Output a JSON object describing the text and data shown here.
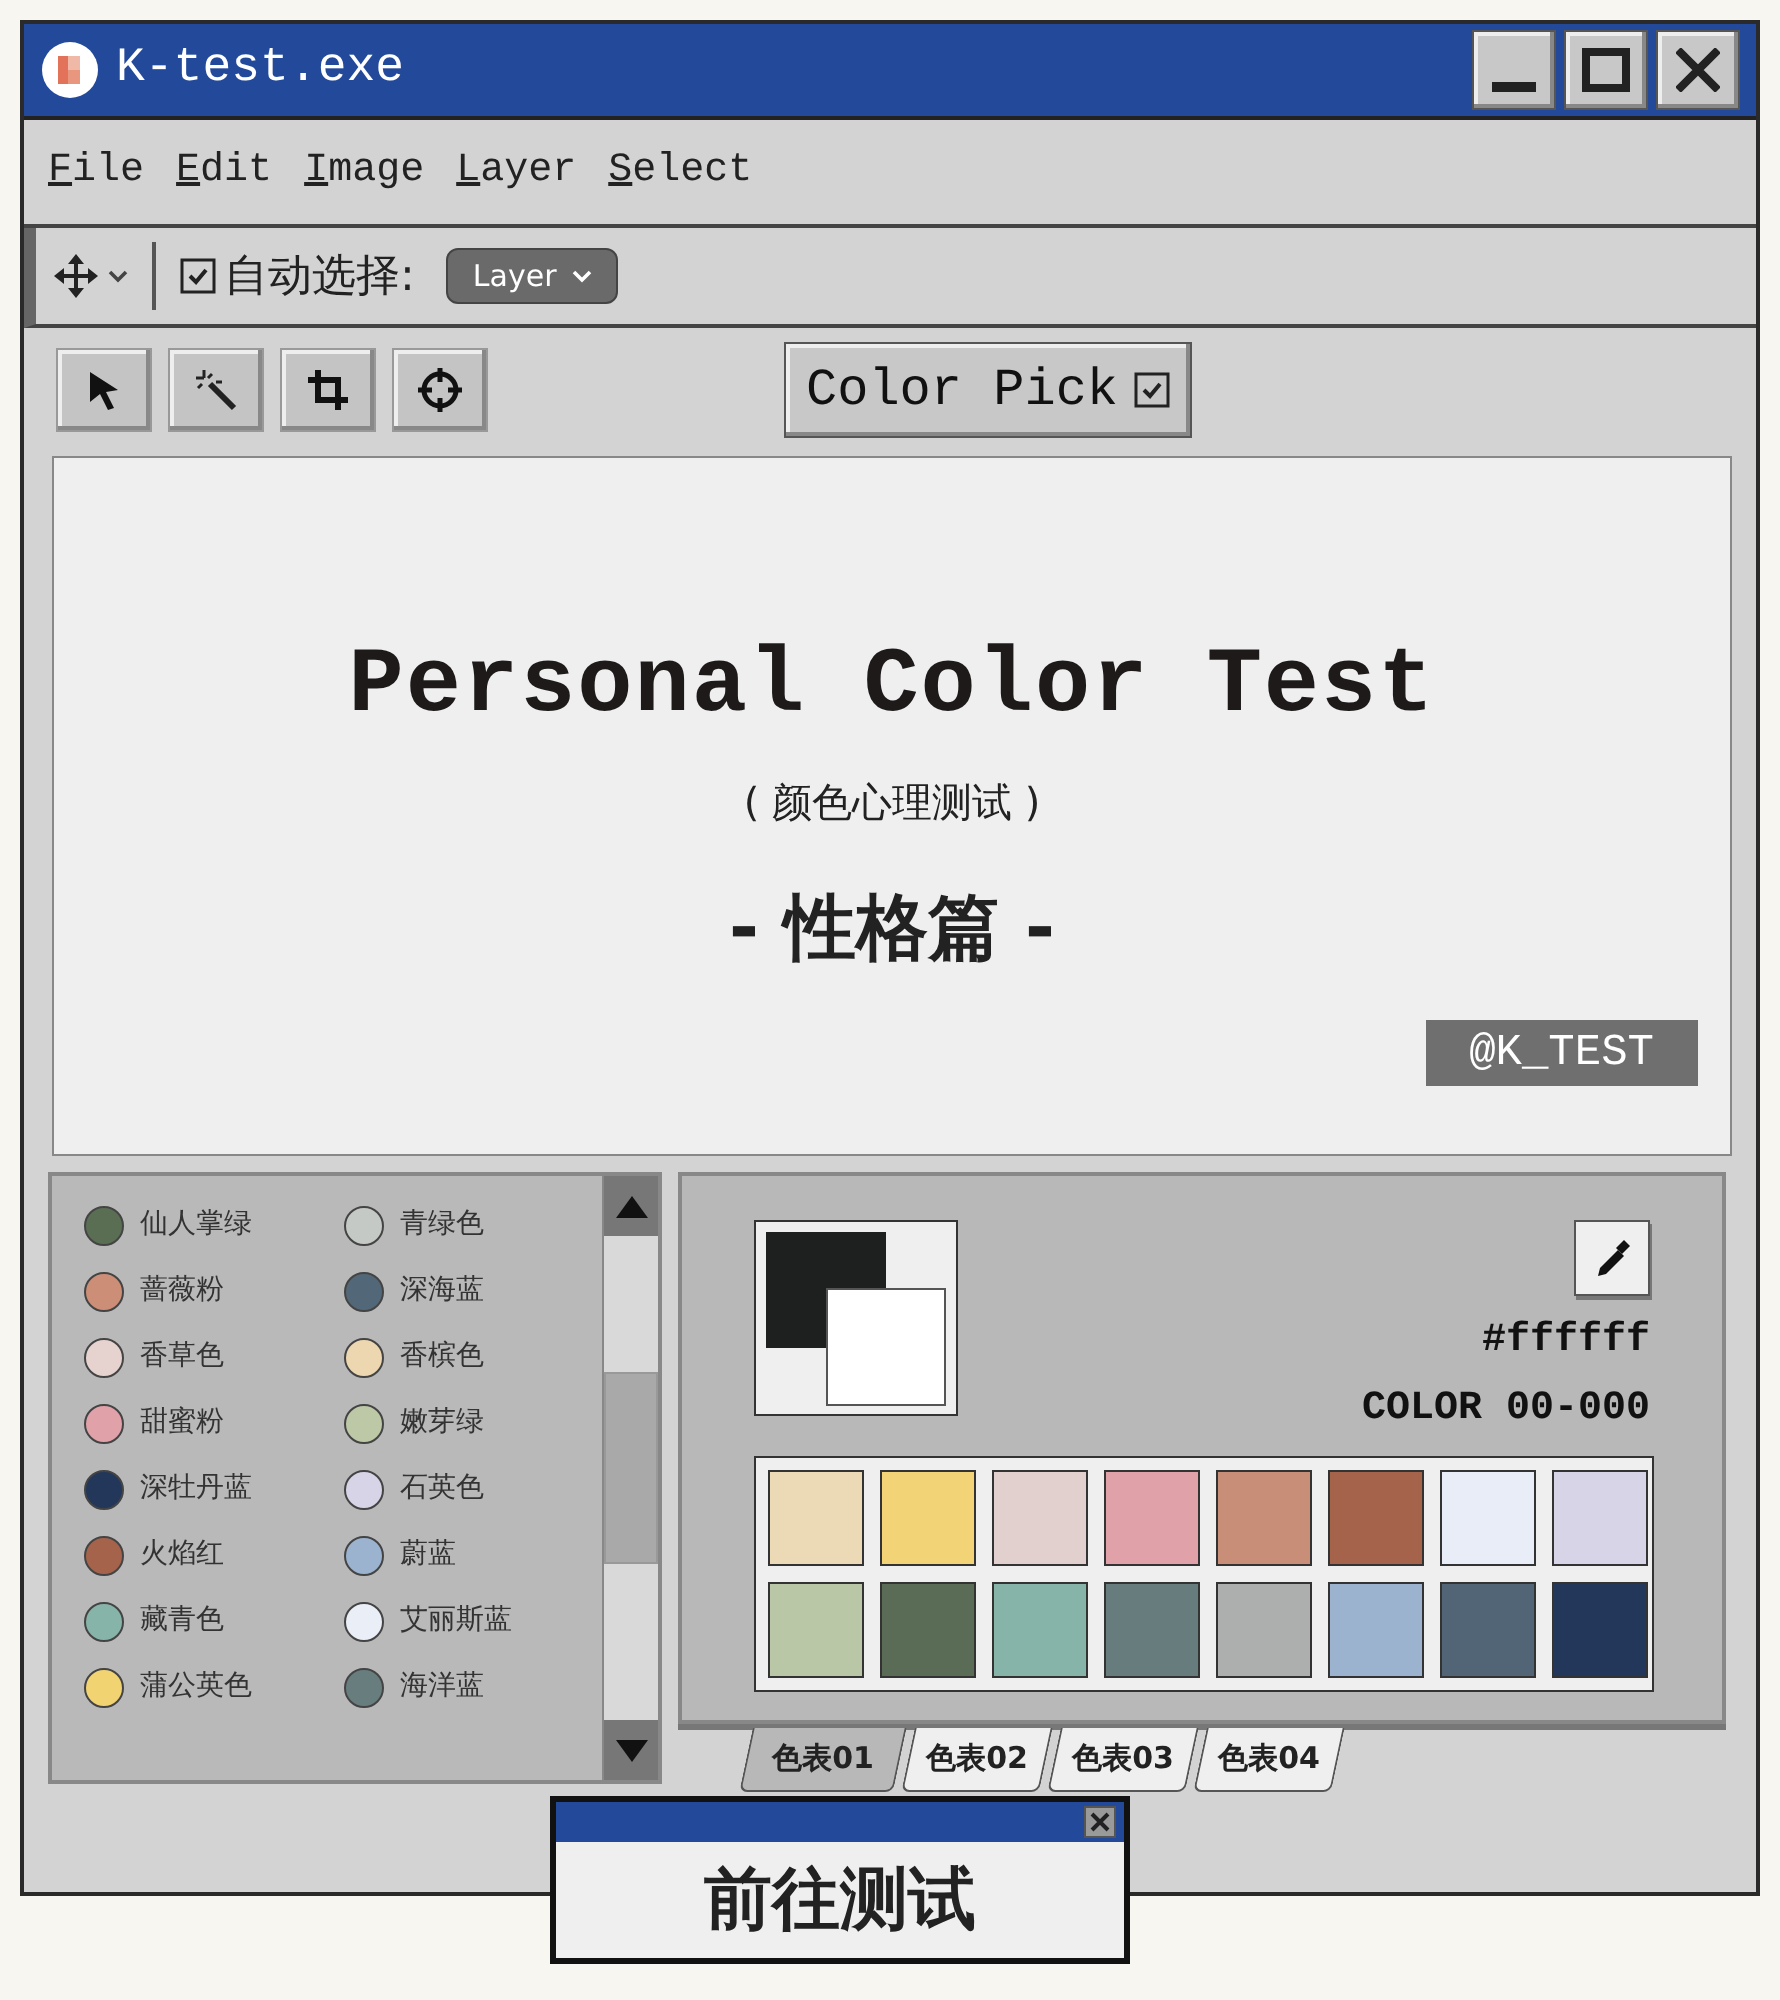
{
  "window": {
    "title": "K-test.exe"
  },
  "menu": [
    {
      "label": "File"
    },
    {
      "label": "Edit"
    },
    {
      "label": "Image"
    },
    {
      "label": "Layer"
    },
    {
      "label": "Select"
    }
  ],
  "toolbar": {
    "auto_select_checked": true,
    "auto_select_label": "自动选择:",
    "layer_dropdown": "Layer"
  },
  "tools": [
    {
      "kind": "arrow"
    },
    {
      "kind": "wand"
    },
    {
      "kind": "crop"
    },
    {
      "kind": "target"
    }
  ],
  "color_pick": {
    "label": "Color Pick",
    "checked": true
  },
  "canvas": {
    "title": "Personal Color Test",
    "subtitle": "( 颜色心理测试 )",
    "heading": "- 性格篇 -",
    "badge": "@K_TEST"
  },
  "color_list": [
    {
      "name": "仙人掌绿",
      "color": "#5a6e53"
    },
    {
      "name": "青绿色",
      "color": "#c5c9c5"
    },
    {
      "name": "蔷薇粉",
      "color": "#cc8e76"
    },
    {
      "name": "深海蓝",
      "color": "#526878"
    },
    {
      "name": "香草色",
      "color": "#e6d3cf"
    },
    {
      "name": "香槟色",
      "color": "#ecd7b1"
    },
    {
      "name": "甜蜜粉",
      "color": "#e0a1a9"
    },
    {
      "name": "嫩芽绿",
      "color": "#bcc8a6"
    },
    {
      "name": "深牡丹蓝",
      "color": "#22375a"
    },
    {
      "name": "石英色",
      "color": "#d7d4e8"
    },
    {
      "name": "火焰红",
      "color": "#a6634b"
    },
    {
      "name": "蔚蓝",
      "color": "#9bb3cf"
    },
    {
      "name": "藏青色",
      "color": "#86b4a8"
    },
    {
      "name": "艾丽斯蓝",
      "color": "#eaeef7"
    },
    {
      "name": "蒲公英色",
      "color": "#f1d372"
    },
    {
      "name": "海洋蓝",
      "color": "#687e7e"
    }
  ],
  "picker": {
    "foreground": {
      "color": "#1e201f"
    },
    "background": {
      "color": "#ffffff"
    },
    "hex": "#ffffff",
    "code": "COLOR 00-000",
    "swatches": [
      {
        "color": "#ecd9b6"
      },
      {
        "color": "#f2d375"
      },
      {
        "color": "#e1d0cd"
      },
      {
        "color": "#e0a1a9"
      },
      {
        "color": "#c98e77"
      },
      {
        "color": "#a6634c"
      },
      {
        "color": "#e9edf7"
      },
      {
        "color": "#d7d4e8"
      },
      {
        "color": "#bac7a6"
      },
      {
        "color": "#5a6c55"
      },
      {
        "color": "#86b4a8"
      },
      {
        "color": "#677c7d"
      },
      {
        "color": "#adafae"
      },
      {
        "color": "#9bb3cf"
      },
      {
        "color": "#526576"
      },
      {
        "color": "#23375a"
      }
    ],
    "tabs": [
      {
        "label": "色表01",
        "selected": true
      },
      {
        "label": "色表02",
        "selected": false
      },
      {
        "label": "色表03",
        "selected": false
      },
      {
        "label": "色表04",
        "selected": false
      }
    ]
  },
  "popup": {
    "label": "前往测试"
  }
}
